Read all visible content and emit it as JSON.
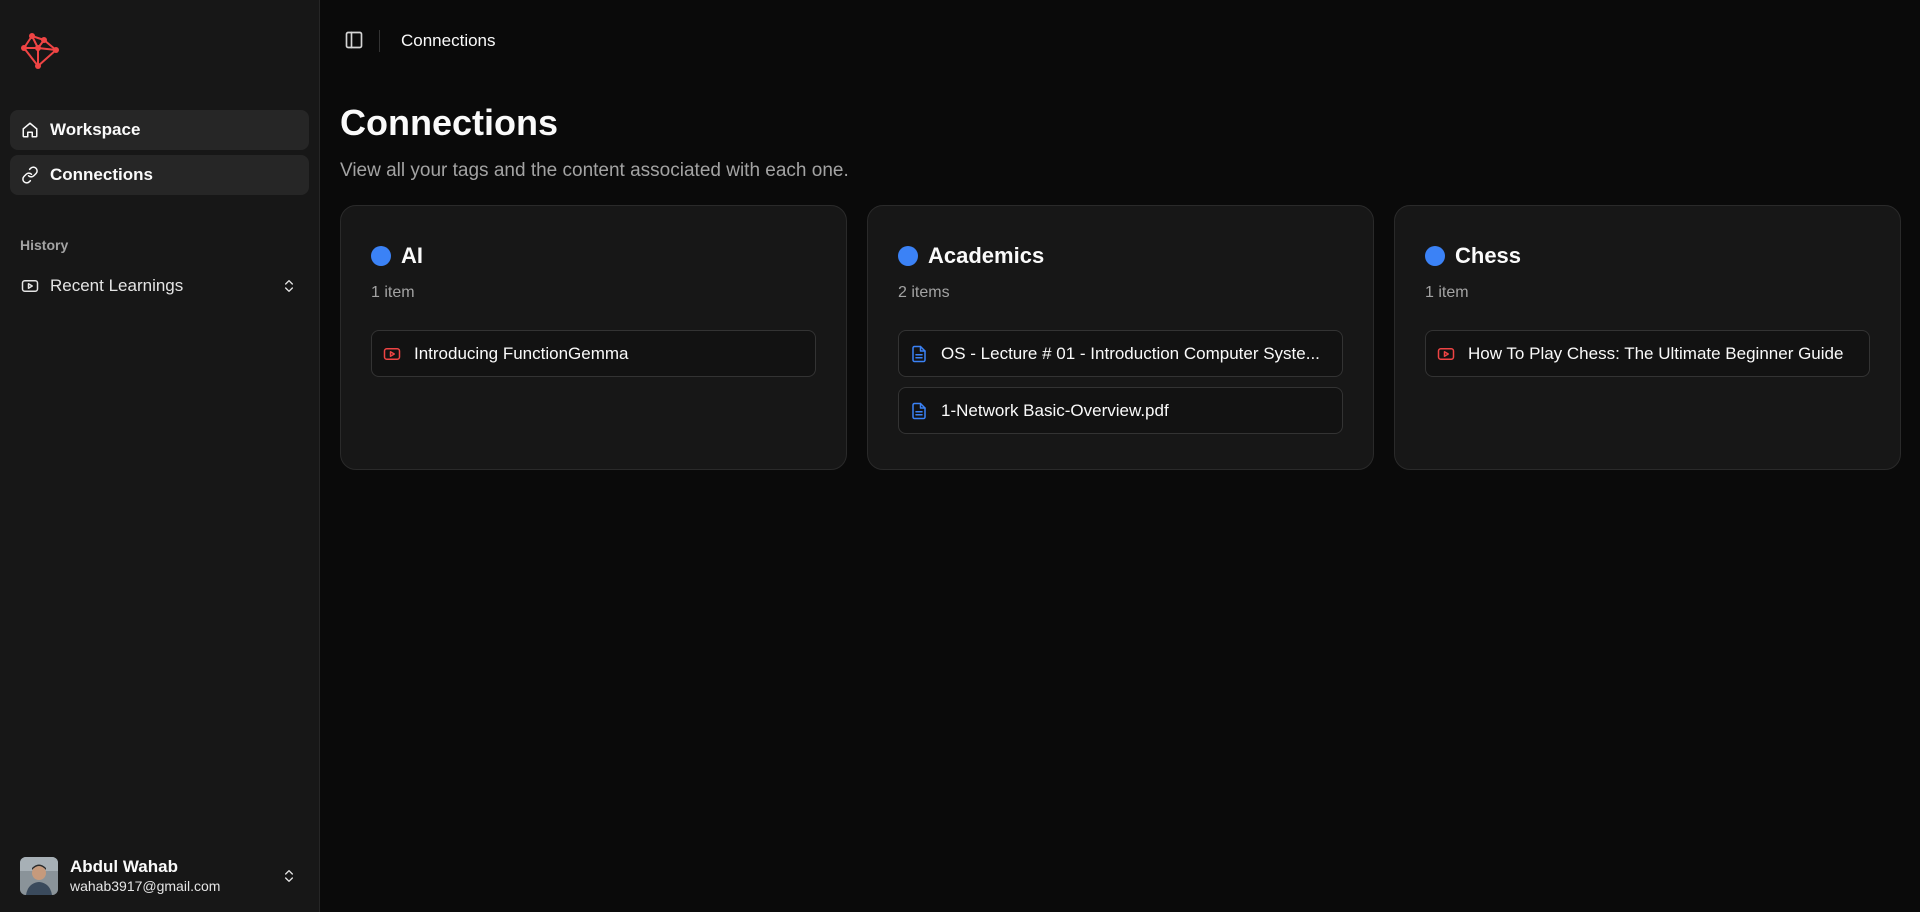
{
  "sidebar": {
    "nav": [
      {
        "label": "Workspace"
      },
      {
        "label": "Connections"
      }
    ],
    "section_label": "History",
    "history": [
      {
        "label": "Recent Learnings"
      }
    ],
    "user": {
      "name": "Abdul Wahab",
      "email": "wahab3917@gmail.com"
    }
  },
  "header": {
    "breadcrumb": "Connections"
  },
  "main": {
    "title": "Connections",
    "subtitle": "View all your tags and the content associated with each one.",
    "tags": [
      {
        "name": "AI",
        "count": "1 item",
        "items": [
          {
            "type": "video",
            "label": "Introducing FunctionGemma"
          }
        ]
      },
      {
        "name": "Academics",
        "count": "2 items",
        "items": [
          {
            "type": "document",
            "label": "OS - Lecture # 01 - Introduction Computer Syste..."
          },
          {
            "type": "document",
            "label": "1-Network Basic-Overview.pdf"
          }
        ]
      },
      {
        "name": "Chess",
        "count": "1 item",
        "items": [
          {
            "type": "video",
            "label": "How To Play Chess: The Ultimate Beginner Guide"
          }
        ]
      }
    ]
  },
  "colors": {
    "accent_dot": "#3b82f6",
    "video_icon": "#ef4444",
    "document_icon": "#3b82f6",
    "logo": "#ef4444"
  }
}
